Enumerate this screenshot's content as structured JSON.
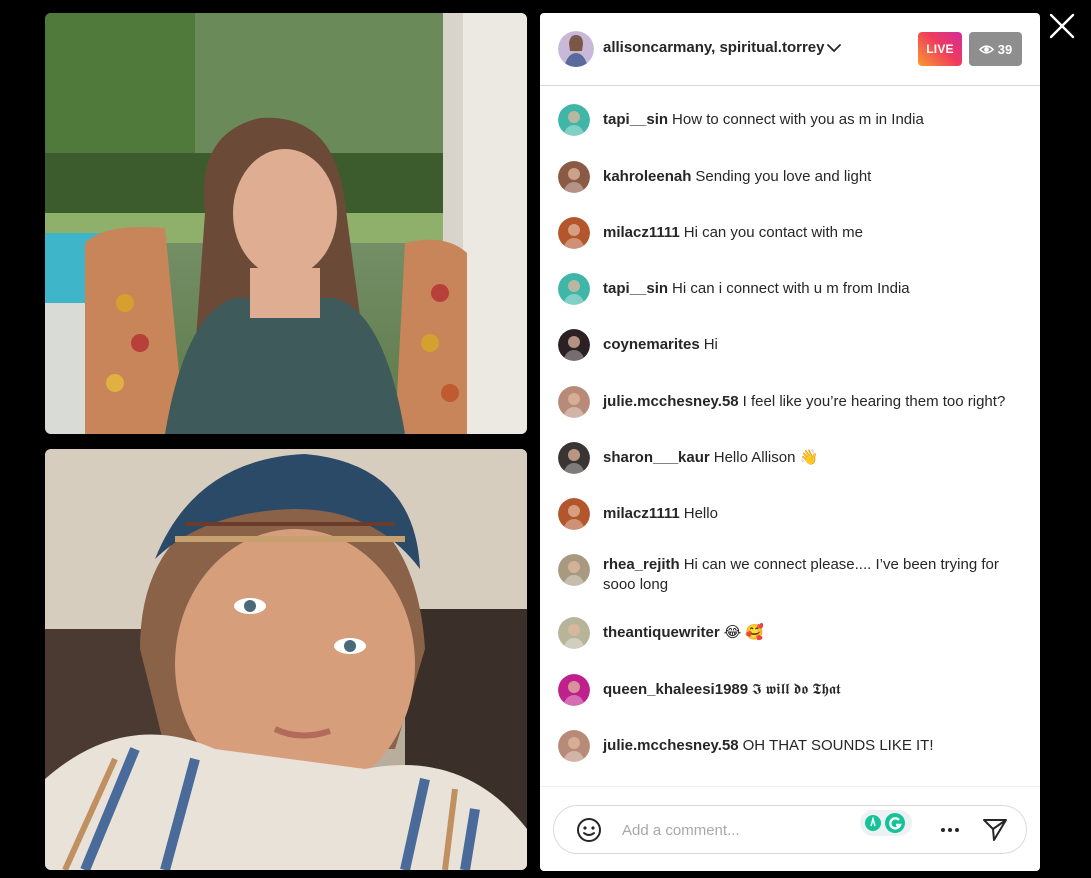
{
  "header": {
    "hosts": "allisoncarmany, spiritual.torrey",
    "live_label": "LIVE",
    "viewer_count": "39"
  },
  "comments": [
    {
      "user": "tapi__sin",
      "text": "How to connect with you as m in India",
      "avatar_color": "#3fb6a8"
    },
    {
      "user": "kahroleenah",
      "text": "Sending you love and light",
      "avatar_color": "#8a5a44"
    },
    {
      "user": "milacz1111",
      "text": "Hi can you contact with me",
      "avatar_color": "#b4562b"
    },
    {
      "user": "tapi__sin",
      "text": "Hi can i connect with u m from India",
      "avatar_color": "#3fb6a8"
    },
    {
      "user": "coynemarites",
      "text": "Hi",
      "avatar_color": "#2b2024"
    },
    {
      "user": "julie.mcchesney.58",
      "text": "I feel like you’re hearing them too right?",
      "avatar_color": "#b88a78"
    },
    {
      "user": "sharon___kaur",
      "text": "Hello Allison 👋",
      "avatar_color": "#3a3533"
    },
    {
      "user": "milacz1111",
      "text": "Hello",
      "avatar_color": "#b4562b"
    },
    {
      "user": "rhea_rejith",
      "text": "Hi can we connect please.... I’ve been trying for sooo long",
      "avatar_color": "#a89a80"
    },
    {
      "user": "theantiquewriter",
      "text": "😂 🥰",
      "avatar_color": "#b8b49a"
    },
    {
      "user": "queen_khaleesi1989",
      "text": "𝕴 𝖜𝖎𝖑𝖑 𝖉𝖔 𝕿𝖍𝖆𝖙",
      "avatar_color": "#c0208c"
    },
    {
      "user": "julie.mcchesney.58",
      "text": "OH THAT SOUNDS LIKE IT!",
      "avatar_color": "#b88a78"
    }
  ],
  "composer": {
    "placeholder": "Add a comment..."
  },
  "icons": {
    "close": "close-icon",
    "chevron": "chevron-down-icon",
    "eye": "eye-icon",
    "emoji": "emoji-icon",
    "more": "more-icon",
    "send": "send-icon"
  }
}
